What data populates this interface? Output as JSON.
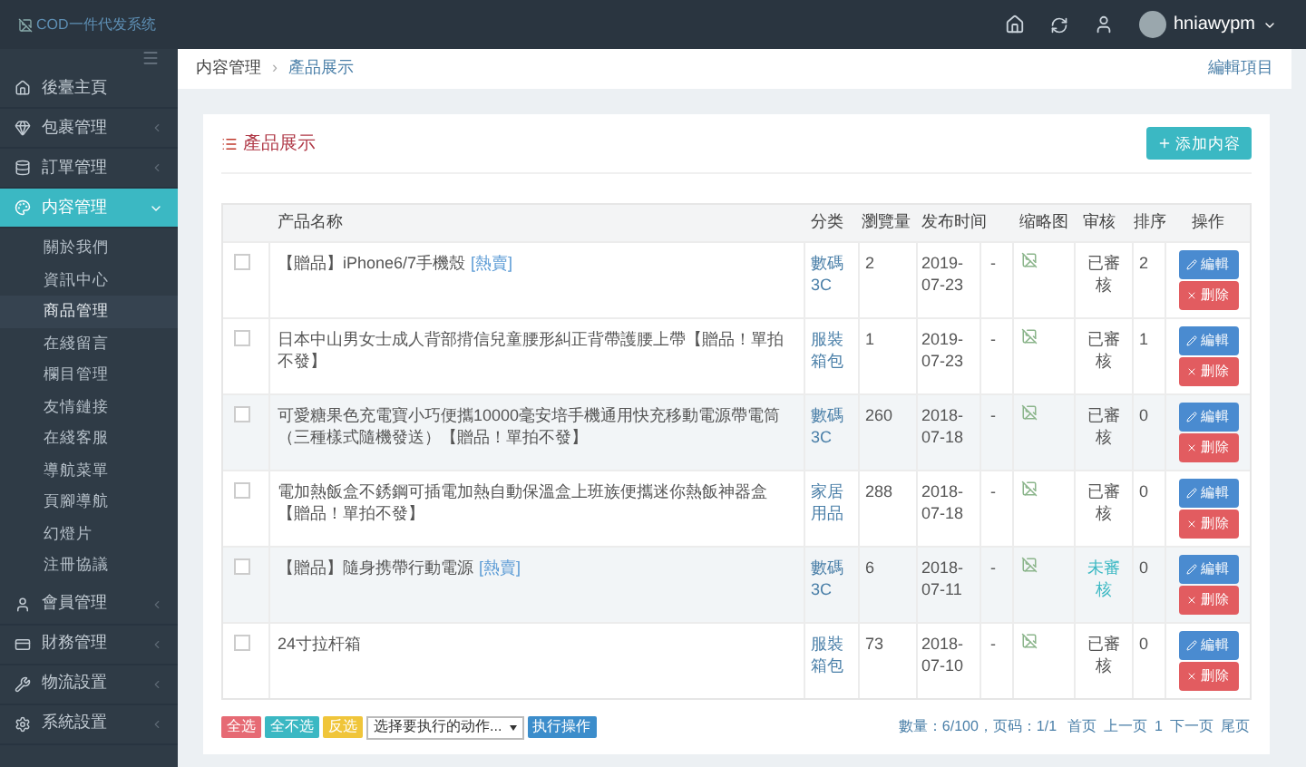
{
  "topbar": {
    "logo_alt": "COD一件代发系统",
    "username": "hniawypm"
  },
  "sidebar": {
    "items": [
      {
        "label": "後臺主頁",
        "selected": false
      },
      {
        "label": "包裹管理",
        "expanded": false,
        "selected": false
      },
      {
        "label": "訂單管理",
        "expanded": false,
        "selected": false
      },
      {
        "label": "内容管理",
        "expanded": true,
        "selected": true,
        "children": [
          {
            "label": "關於我們",
            "selected": false
          },
          {
            "label": "資訊中心",
            "selected": false
          },
          {
            "label": "商品管理",
            "selected": true
          },
          {
            "label": "在綫留言",
            "selected": false
          },
          {
            "label": "欄目管理",
            "selected": false
          },
          {
            "label": "友情鏈接",
            "selected": false
          },
          {
            "label": "在綫客服",
            "selected": false
          },
          {
            "label": "導航菜單",
            "selected": false
          },
          {
            "label": "頁腳導航",
            "selected": false
          },
          {
            "label": "幻燈片",
            "selected": false
          },
          {
            "label": "注冊協議",
            "selected": false
          }
        ]
      },
      {
        "label": "會員管理",
        "expanded": false,
        "selected": false
      },
      {
        "label": "財務管理",
        "expanded": false,
        "selected": false
      },
      {
        "label": "物流設置",
        "expanded": false,
        "selected": false
      },
      {
        "label": "系統設置",
        "expanded": false,
        "selected": false
      }
    ]
  },
  "breadcrumb": {
    "items": [
      "内容管理",
      "產品展示"
    ],
    "separator": "›",
    "action": "編輯項目"
  },
  "panel": {
    "title": "產品展示",
    "add_button": "添加内容"
  },
  "table": {
    "columns": [
      "产品名称",
      "分类",
      "瀏覽量",
      "发布时间",
      "缩略图",
      "审核",
      "排序",
      "操作"
    ],
    "rows": [
      {
        "checked": false,
        "highlighted": false,
        "name": "【贈品】iPhone6/7手機殼",
        "tag": "[熱賣]",
        "category": "數碼3C",
        "views": "2",
        "date": "2019-07-23",
        "dash": "-",
        "status": "已審核",
        "approved": true,
        "order": "2",
        "edit_button": "編輯",
        "delete_button": "删除"
      },
      {
        "checked": false,
        "highlighted": false,
        "name": "日本中山男女士成人背部揹信兒童腰形糾正背帶護腰上帶【贈品！單拍不發】",
        "category": "服裝箱包",
        "views": "1",
        "date": "2019-07-23",
        "dash": "-",
        "status": "已審核",
        "approved": true,
        "order": "1",
        "edit_button": "編輯",
        "delete_button": "删除"
      },
      {
        "checked": false,
        "highlighted": true,
        "name": "可愛糖果色充電寶小巧便攜10000毫安培手機通用快充移動電源帶電筒（三種樣式隨機發送）【贈品！單拍不發】",
        "category": "數碼3C",
        "views": "260",
        "date": "2018-07-18",
        "dash": "-",
        "status": "已審核",
        "approved": true,
        "order": "0",
        "edit_button": "編輯",
        "delete_button": "删除"
      },
      {
        "checked": false,
        "highlighted": false,
        "name": "電加熱飯盒不銹鋼可插電加熱自動保溫盒上班族便攜迷你熱飯神器盒【贈品！單拍不發】",
        "category": "家居用品",
        "views": "288",
        "date": "2018-07-18",
        "dash": "-",
        "status": "已審核",
        "approved": true,
        "order": "0",
        "edit_button": "編輯",
        "delete_button": "删除"
      },
      {
        "checked": false,
        "highlighted": true,
        "name": "【贈品】隨身携帶行動電源",
        "tag": "[熱賣]",
        "category": "數碼3C",
        "views": "6",
        "date": "2018-07-11",
        "dash": "-",
        "status": "未審核",
        "approved": false,
        "order": "0",
        "edit_button": "編輯",
        "delete_button": "删除"
      },
      {
        "checked": false,
        "highlighted": false,
        "name": "24寸拉杆箱",
        "category": "服裝箱包",
        "views": "73",
        "date": "2018-07-10",
        "dash": "-",
        "status": "已審核",
        "approved": true,
        "order": "0",
        "edit_button": "編輯",
        "delete_button": "删除"
      }
    ]
  },
  "footer": {
    "select_all": "全选",
    "select_none": "全不选",
    "invert": "反选",
    "action_select": "选择要执行的动作...",
    "execute": "执行操作",
    "summary": "數量：6/100，页码：1/1",
    "pages": [
      "首页",
      "上一页",
      "1",
      "下一页",
      "尾页"
    ]
  }
}
